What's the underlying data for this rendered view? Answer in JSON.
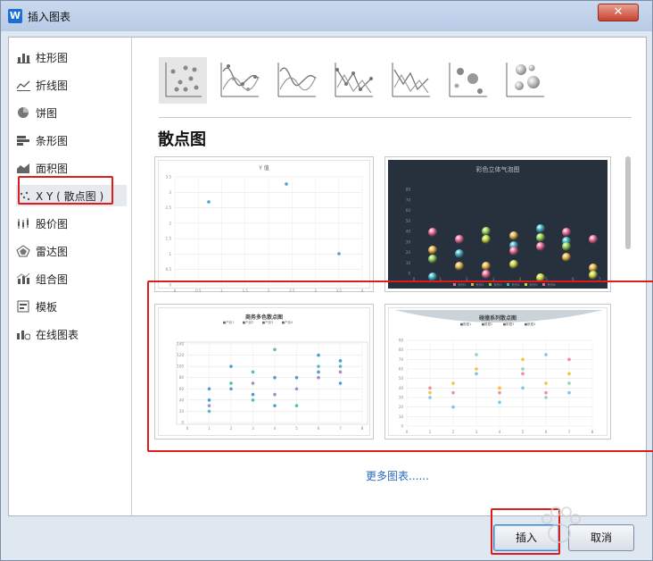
{
  "window": {
    "title": "插入图表",
    "app_icon": "W"
  },
  "sidebar": {
    "items": [
      {
        "label": "柱形图",
        "icon": "column-chart-icon"
      },
      {
        "label": "折线图",
        "icon": "line-chart-icon"
      },
      {
        "label": "饼图",
        "icon": "pie-chart-icon"
      },
      {
        "label": "条形图",
        "icon": "bar-chart-icon"
      },
      {
        "label": "面积图",
        "icon": "area-chart-icon"
      },
      {
        "label": "X Y ( 散点图 )",
        "icon": "scatter-chart-icon",
        "selected": true
      },
      {
        "label": "股价图",
        "icon": "stock-chart-icon"
      },
      {
        "label": "雷达图",
        "icon": "radar-chart-icon"
      },
      {
        "label": "组合图",
        "icon": "combo-chart-icon"
      },
      {
        "label": "模板",
        "icon": "template-icon"
      },
      {
        "label": "在线图表",
        "icon": "online-chart-icon"
      }
    ]
  },
  "subtypes": [
    "scatter-icon",
    "smooth-line-markers-icon",
    "smooth-line-icon",
    "straight-line-markers-icon",
    "straight-line-icon",
    "bubble-icon",
    "3d-bubble-icon"
  ],
  "section_title": "散点图",
  "previews": [
    {
      "title": "Y 值",
      "y_ticks": [
        "3.5",
        "3",
        "2.5",
        "2",
        "1.5",
        "1",
        "0.5",
        "0"
      ],
      "x_ticks": [
        "0",
        "0.5",
        "1",
        "1.5",
        "2",
        "2.5",
        "3",
        "3.5",
        "4"
      ]
    },
    {
      "title": "彩色立体气泡图",
      "y_ticks": [
        "80",
        "70",
        "60",
        "50",
        "40",
        "30",
        "20",
        "10",
        "0"
      ],
      "x_ticks": [
        "0",
        "1",
        "2",
        "3",
        "4",
        "5",
        "6",
        "7"
      ],
      "legend": [
        "系列1",
        "系列2",
        "系列3",
        "系列4",
        "系列5",
        "系列6"
      ]
    },
    {
      "title": "商务多色散点图",
      "legend": [
        "■产品1",
        "■产品2",
        "■产品3",
        "■产品4"
      ],
      "y_ticks": [
        "140",
        "120",
        "100",
        "80",
        "60",
        "40",
        "20",
        "0"
      ],
      "x_ticks": [
        "0",
        "1",
        "2",
        "3",
        "4",
        "5",
        "6",
        "7",
        "8"
      ]
    },
    {
      "title": "碰撞系列散点图",
      "legend": [
        "■数据1",
        "■数据2",
        "■数据3",
        "■数据4"
      ],
      "y_ticks": [
        "90",
        "80",
        "70",
        "60",
        "50",
        "40",
        "30",
        "20",
        "10",
        "0"
      ],
      "x_ticks": [
        "0",
        "1",
        "2",
        "3",
        "4",
        "5",
        "6",
        "7",
        "8"
      ]
    }
  ],
  "more_link": "更多图表......",
  "buttons": {
    "insert": "插入",
    "cancel": "取消"
  },
  "close_glyph": "✕",
  "watermark_icon": "paw-icon",
  "colors": {
    "accent": "#2a6cc0",
    "highlight": "#e01b1b",
    "dark_preview_bg": "#27303d"
  }
}
